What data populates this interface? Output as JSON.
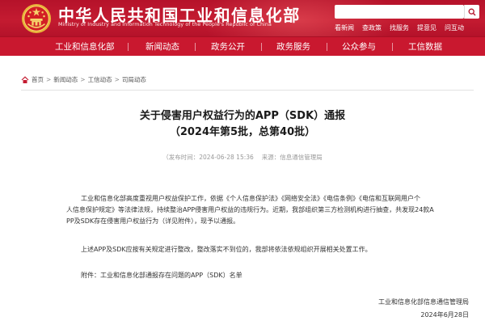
{
  "header": {
    "title_cn": "中华人民共和国工业和信息化部",
    "title_en": "Ministry of Industry and Information Technology of the People's Republic of China",
    "search_placeholder": "",
    "top_links": [
      "看新闻",
      "查政策",
      "找服务",
      "提意见",
      "问互动"
    ],
    "accent_color": "#c41b31"
  },
  "nav": {
    "items": [
      "工业和信息化部",
      "新闻动态",
      "政务公开",
      "政务服务",
      "公众参与",
      "工信数据"
    ]
  },
  "breadcrumb": {
    "items": [
      "首页",
      "新闻动态",
      "工信动态",
      "司局动态"
    ],
    "separator": ">"
  },
  "article": {
    "title_line1": "关于侵害用户权益行为的APP（SDK）通报",
    "title_line2": "（2024年第5批，总第40批）",
    "publish_time": "（发布时间：2024-06-28 15:36",
    "source": "来源：信息通信管理局",
    "para1": [
      "工业和信息化部高度重视用户权益保护工作，依据《个人信息保护法》《网络安全法》《电信条例》《电信和互联网用户个",
      "人信息保护规定》等法律法规，持续整治APP侵害用户权益的违规行为。近期，我部组织第三方检测机构进行抽查，共发现24款A",
      "PP及SDK存在侵害用户权益行为（详见附件），现予以通报。"
    ],
    "para2": "上述APP及SDK应按有关规定进行整改，整改落实不到位的，我部将依法依规组织开展相关处置工作。",
    "attachment": "附件：工业和信息化部通报存在问题的APP（SDK）名单",
    "signer": "工业和信息化部信息通信管理局",
    "date": "2024年6月28日"
  }
}
